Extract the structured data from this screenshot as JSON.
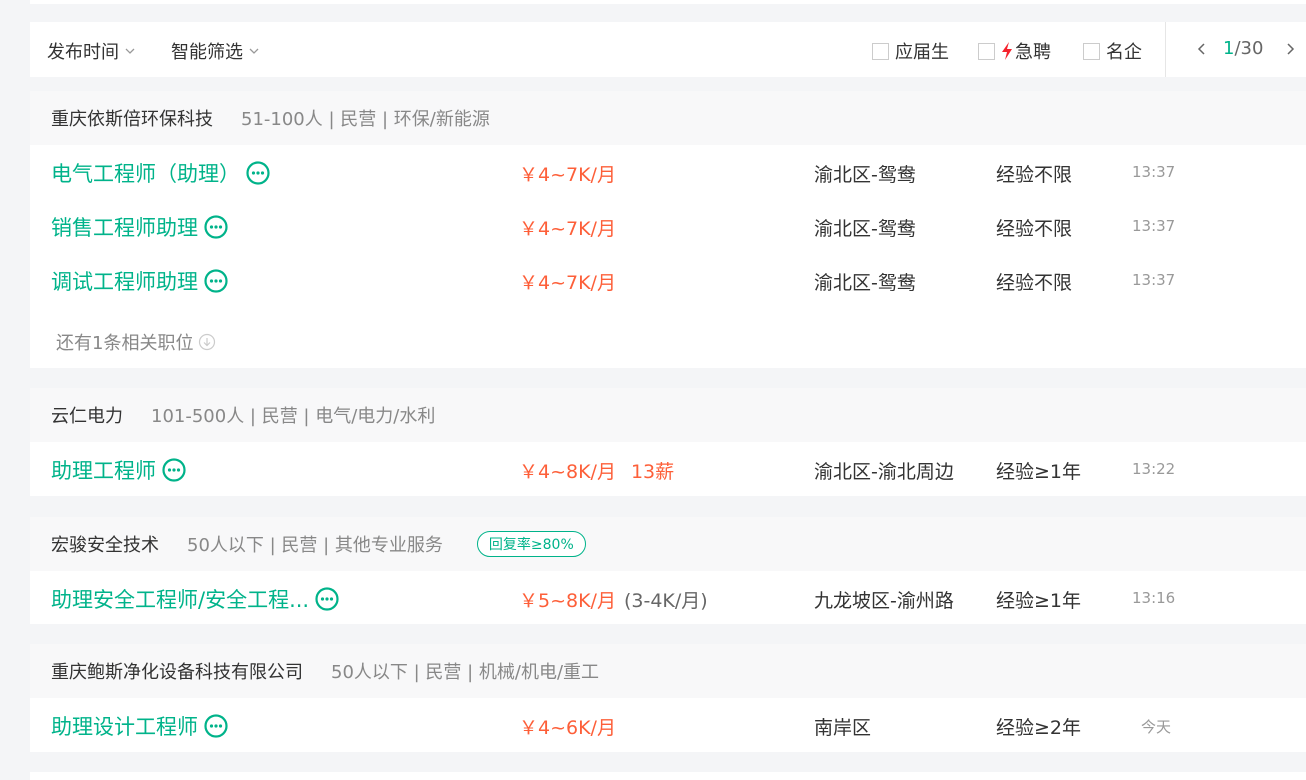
{
  "filters": {
    "publish_time": "发布时间",
    "smart_filter": "智能筛选",
    "graduate": "应届生",
    "urgent": "急聘",
    "famous": "名企"
  },
  "pager": {
    "current": "1",
    "total": "/30"
  },
  "colors": {
    "accent": "#00b38a",
    "salary": "#fd5f39",
    "urgent_bolt": "#f5222d"
  },
  "companies": [
    {
      "name": "重庆依斯倍环保科技",
      "info": "51-100人 | 民营 | 环保/新能源",
      "jobs": [
        {
          "title": "电气工程师（助理）",
          "salary": "￥4~7K/月",
          "location": "渝北区-鸳鸯",
          "experience": "经验不限",
          "time": "13:37"
        },
        {
          "title": "销售工程师助理",
          "salary": "￥4~7K/月",
          "location": "渝北区-鸳鸯",
          "experience": "经验不限",
          "time": "13:37"
        },
        {
          "title": "调试工程师助理",
          "salary": "￥4~7K/月",
          "location": "渝北区-鸳鸯",
          "experience": "经验不限",
          "time": "13:37"
        }
      ],
      "more": "还有1条相关职位"
    },
    {
      "name": "云仁电力",
      "info": "101-500人 | 民营 | 电气/电力/水利",
      "jobs": [
        {
          "title": "助理工程师",
          "salary": "￥4~8K/月",
          "salary_extra": "13薪",
          "location": "渝北区-渝北周边",
          "experience": "经验≥1年",
          "time": "13:22"
        }
      ]
    },
    {
      "name": "宏骏安全技术",
      "info": "50人以下 | 民营 | 其他专业服务",
      "badge": "回复率≥80%",
      "jobs": [
        {
          "title": "助理安全工程师/安全工程...",
          "salary": "￥5~8K/月",
          "salary_intern": "(3-4K/月)",
          "location": "九龙坡区-渝州路",
          "experience": "经验≥1年",
          "time": "13:16"
        }
      ]
    },
    {
      "name": "重庆鲍斯净化设备科技有限公司",
      "info": "50人以下 | 民营 | 机械/机电/重工",
      "jobs": [
        {
          "title": "助理设计工程师",
          "salary": "￥4~6K/月",
          "location": "南岸区",
          "experience": "经验≥2年",
          "time": "今天"
        }
      ]
    }
  ]
}
